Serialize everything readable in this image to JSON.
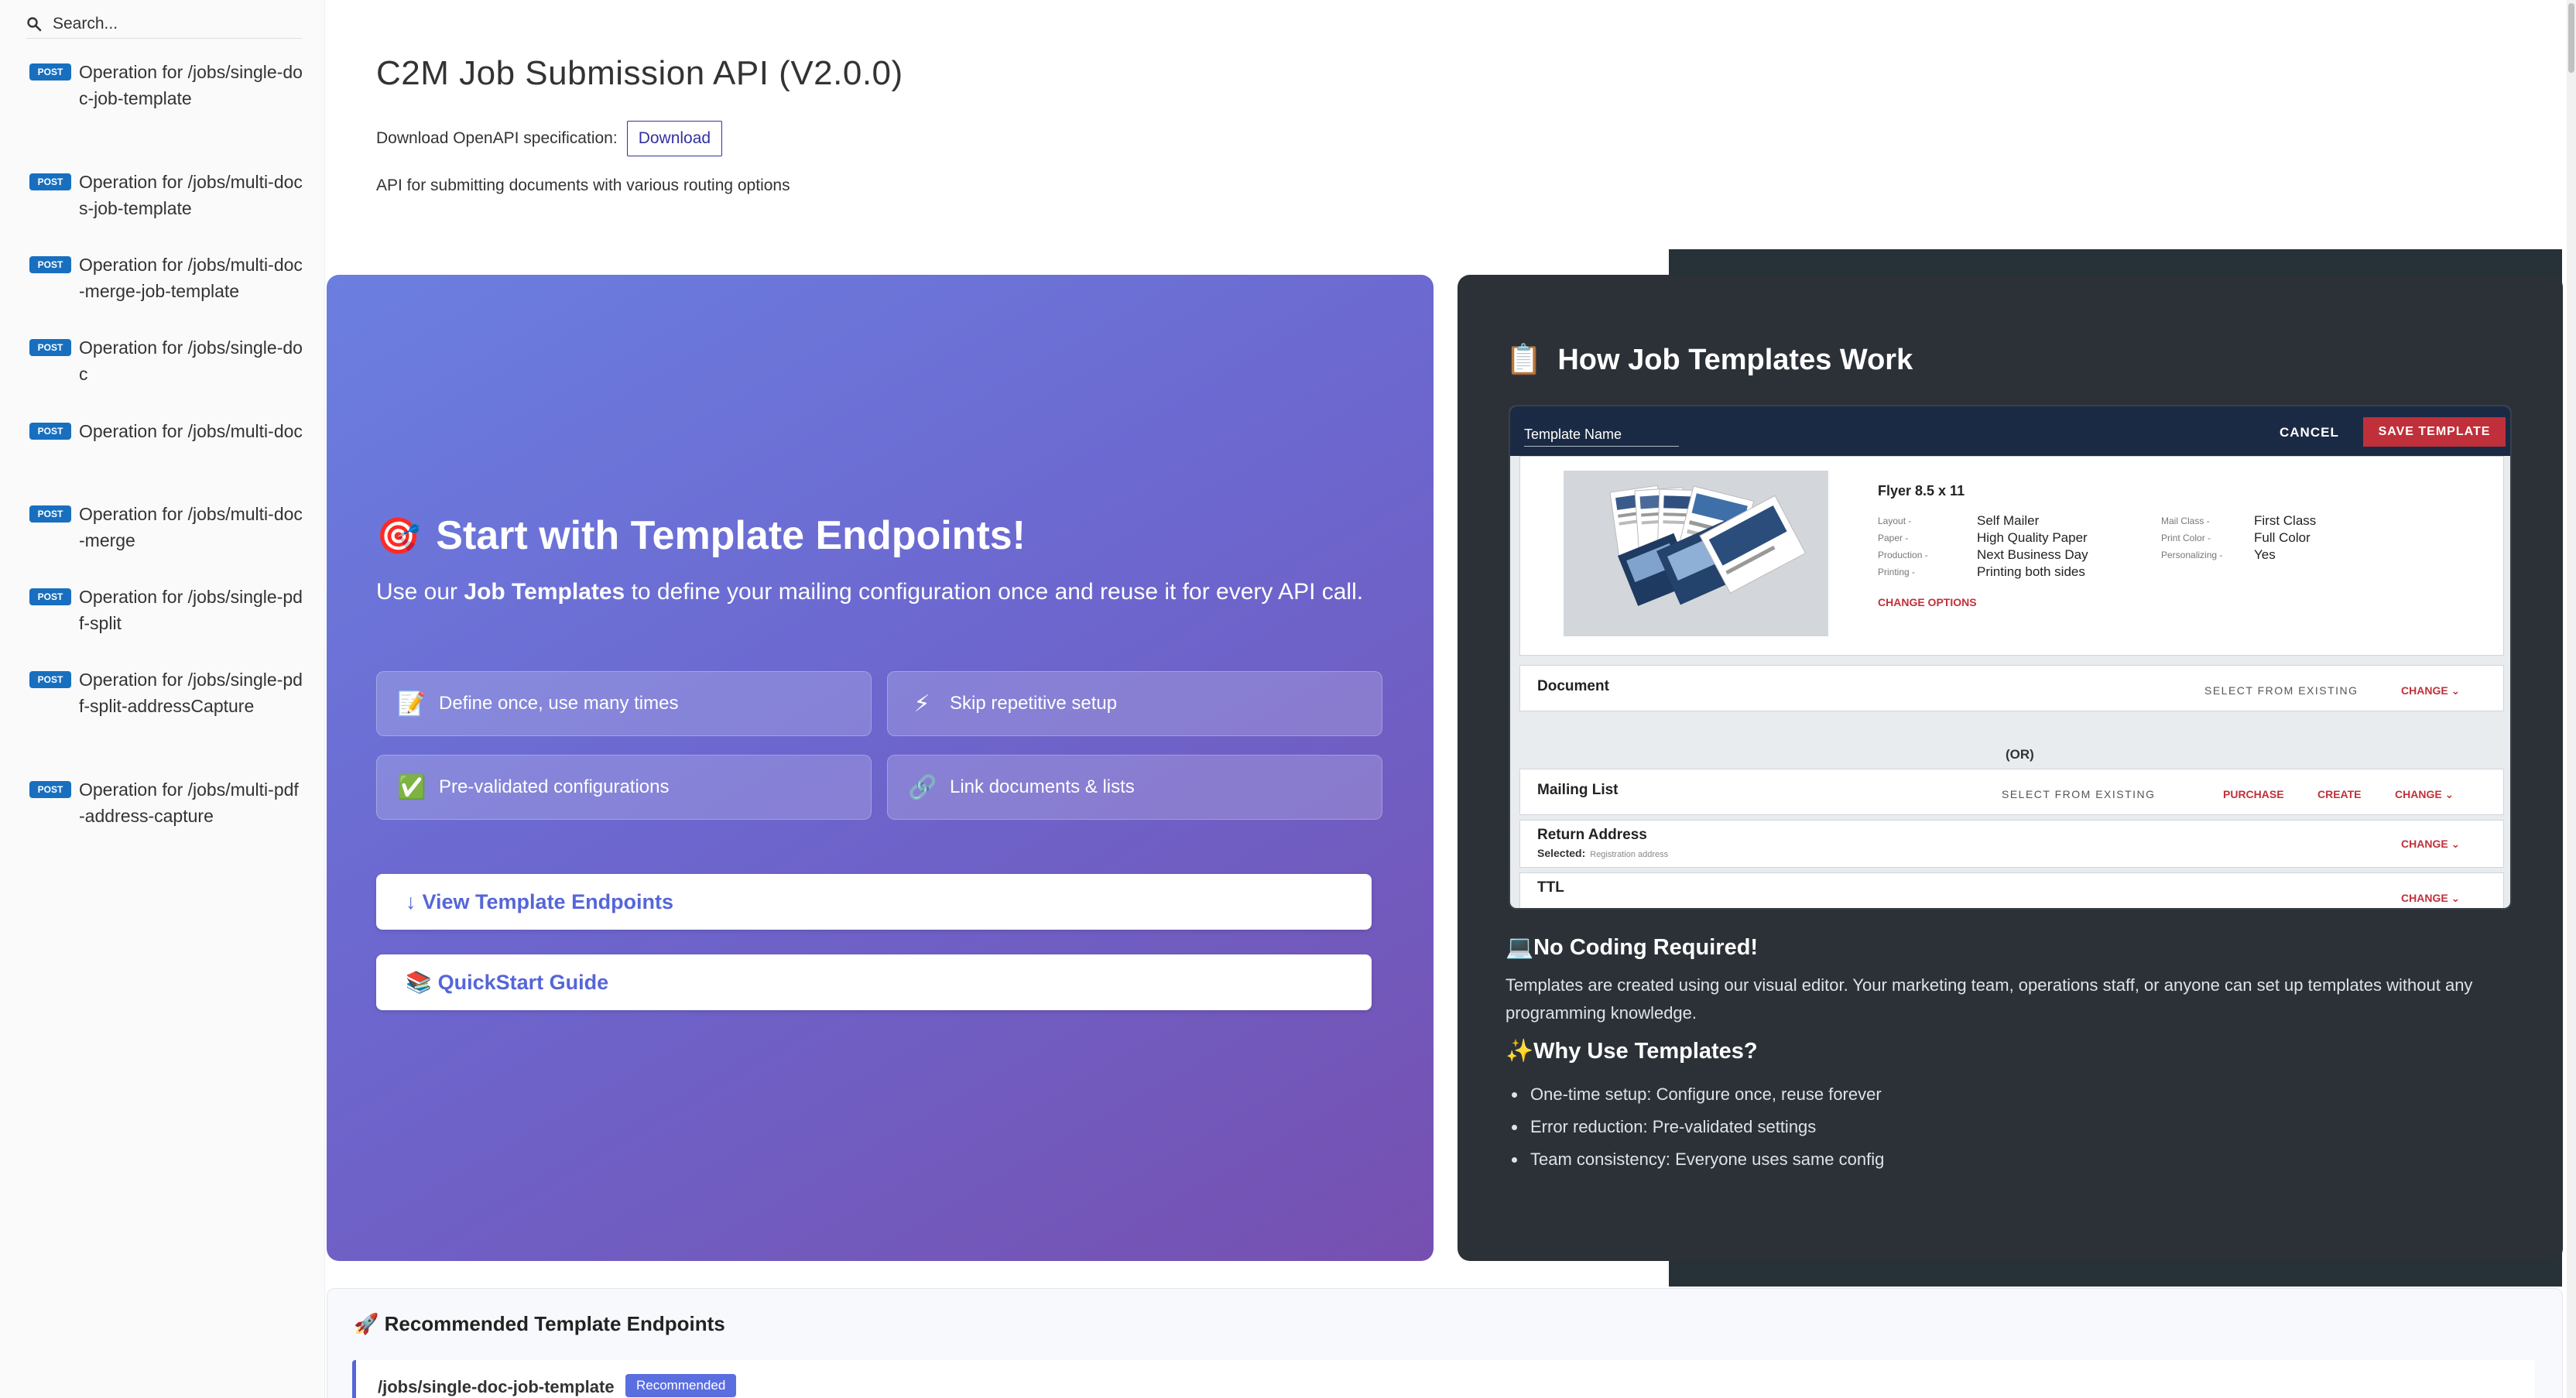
{
  "sidebar": {
    "search_placeholder": "Search...",
    "items": [
      {
        "method": "POST",
        "label": "Operation for /jobs/single-doc-job-template"
      },
      {
        "method": "POST",
        "label": "Operation for /jobs/multi-docs-job-template"
      },
      {
        "method": "POST",
        "label": "Operation for /jobs/multi-doc-merge-job-template"
      },
      {
        "method": "POST",
        "label": "Operation for /jobs/single-doc"
      },
      {
        "method": "POST",
        "label": "Operation for /jobs/multi-doc"
      },
      {
        "method": "POST",
        "label": "Operation for /jobs/multi-doc-merge"
      },
      {
        "method": "POST",
        "label": "Operation for /jobs/single-pdf-split"
      },
      {
        "method": "POST",
        "label": "Operation for /jobs/single-pdf-split-addressCapture"
      },
      {
        "method": "POST",
        "label": "Operation for /jobs/multi-pdf-address-capture"
      }
    ]
  },
  "header": {
    "title": "C2M Job Submission API (V2.0.0)",
    "download_label": "Download OpenAPI specification:",
    "download_button": "Download",
    "description": "API for submitting documents with various routing options"
  },
  "hero": {
    "emoji": "🎯",
    "title": "Start with Template Endpoints!",
    "subtitle_pre": "Use our ",
    "subtitle_bold": "Job Templates",
    "subtitle_post": " to define your mailing configuration once and reuse it for every API call.",
    "features": [
      {
        "icon": "📝",
        "label": "Define once, use many times"
      },
      {
        "icon": "⚡",
        "label": "Skip repetitive setup"
      },
      {
        "icon": "✅",
        "label": "Pre-validated configurations"
      },
      {
        "icon": "🔗",
        "label": "Link documents & lists"
      }
    ],
    "buttons": [
      {
        "icon": "↓",
        "label": "View Template Endpoints"
      },
      {
        "icon": "📚",
        "label": "QuickStart Guide"
      }
    ]
  },
  "how": {
    "emoji": "📋",
    "title": "How Job Templates Work",
    "mock": {
      "template_name": "Template Name",
      "cancel": "CANCEL",
      "save": "SAVE TEMPLATE",
      "flyer_name": "Flyer 8.5 x 11",
      "specs_left": [
        {
          "k": "Layout -",
          "v": "Self Mailer"
        },
        {
          "k": "Paper -",
          "v": "High Quality Paper"
        },
        {
          "k": "Production -",
          "v": "Next Business Day"
        },
        {
          "k": "Printing -",
          "v": "Printing both sides"
        }
      ],
      "specs_right": [
        {
          "k": "Mail Class -",
          "v": "First Class"
        },
        {
          "k": "Print Color -",
          "v": "Full Color"
        },
        {
          "k": "Personalizing -",
          "v": "Yes"
        }
      ],
      "change_options": "CHANGE OPTIONS",
      "document": "Document",
      "select_existing": "SELECT FROM EXISTING",
      "change": "CHANGE",
      "or": "(OR)",
      "mailing_list": "Mailing List",
      "purchase": "PURCHASE",
      "create": "CREATE",
      "return_address": "Return Address",
      "selected_label": "Selected:",
      "selected_value": "Registration address",
      "ttl": "TTL"
    },
    "no_coding_title": "💻No Coding Required!",
    "no_coding_text": "Templates are created using our visual editor. Your marketing team, operations staff, or anyone can set up templates without any programming knowledge.",
    "why_title": "✨Why Use Templates?",
    "why_items": [
      "One-time setup: Configure once, reuse forever",
      "Error reduction: Pre-validated settings",
      "Team consistency: Everyone uses same config"
    ]
  },
  "recommended": {
    "title": "🚀 Recommended Template Endpoints",
    "item_path": "/jobs/single-doc-job-template",
    "item_badge": "Recommended"
  },
  "colors": {
    "accent": "#5566d8",
    "post_badge": "#186fbf",
    "dark_panel": "#263238",
    "mock_red": "#c0303a"
  }
}
